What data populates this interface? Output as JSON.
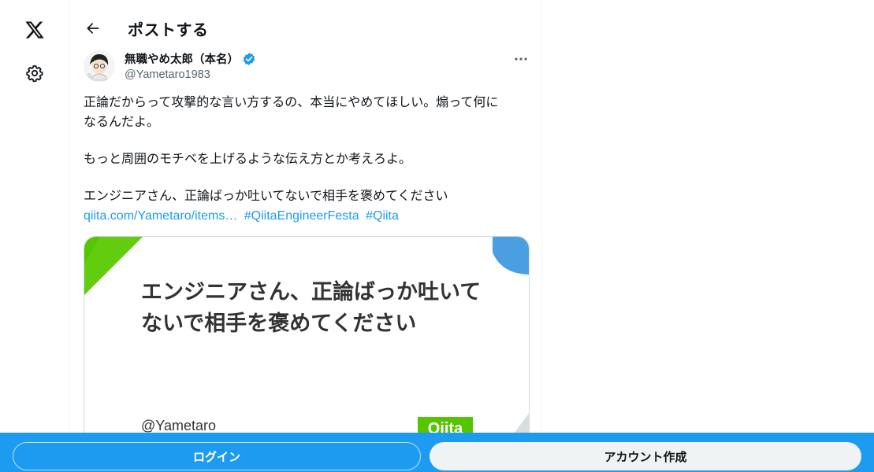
{
  "nav": {
    "logo_icon": "x-logo-icon",
    "settings_icon": "gear-icon"
  },
  "header": {
    "title": "ポストする",
    "back_icon": "arrow-left-icon"
  },
  "post": {
    "author": {
      "display_name": "無職やめ太郎（本名）",
      "handle": "@Yametaro1983",
      "verified": true,
      "verified_color": "#1d9bf0"
    },
    "more_icon": "more-horizontal-icon",
    "text_lines": [
      "正論だからって攻撃的な言い方するの、本当にやめてほしい。煽って何に",
      "なるんだよ。",
      "もっと周囲のモチベを上げるような伝え方とか考えろよ。",
      "エンジニアさん、正論ばっか吐いてないで相手を褒めてください"
    ],
    "links": {
      "url": "qiita.com/Yametaro/items…",
      "hashtag1": "#QiitaEngineerFesta",
      "hashtag2": "#Qiita"
    },
    "link_color": "#1d9bf0",
    "card": {
      "title": "エンジニアさん、正論ばっか吐いてないで相手を褒めてください",
      "author": "@Yametaro",
      "logo_text": "Qiita",
      "logo_color": "#55c500",
      "accent_green": "#55c500",
      "accent_blue": "#4a9fe0"
    }
  },
  "footer": {
    "login_label": "ログイン",
    "signup_label": "アカウント作成",
    "bar_color": "#1d9bf0"
  }
}
